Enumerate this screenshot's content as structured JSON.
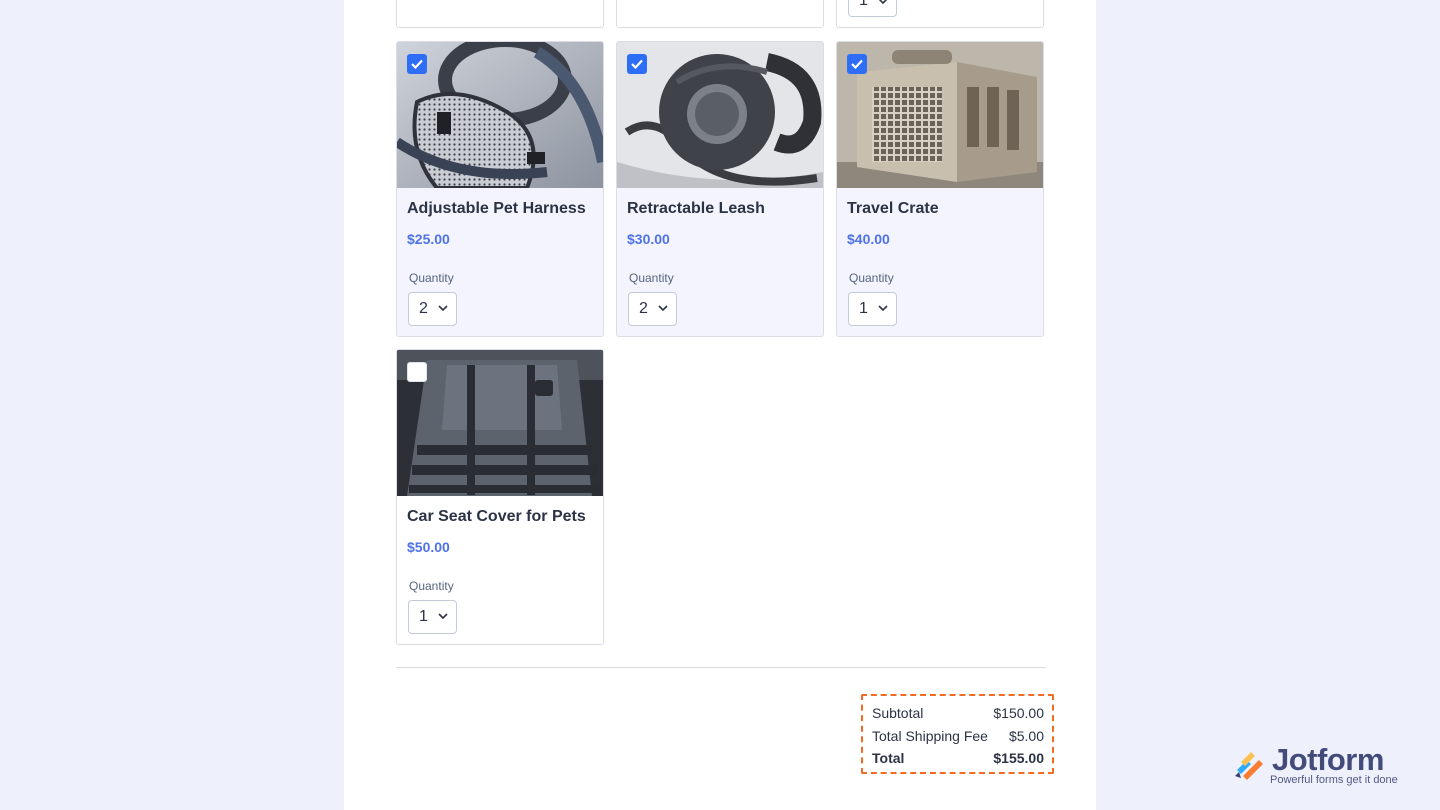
{
  "quantity_label": "Quantity",
  "accent_color": "#2e6ef7",
  "price_color": "#4f72e6",
  "summary_border_color": "#f26b22",
  "top_row_partial": {
    "visible_quantity": "1"
  },
  "products": [
    {
      "name": "Adjustable Pet Harness",
      "price": "$25.00",
      "quantity": "2",
      "selected": true,
      "icon": "harness-image"
    },
    {
      "name": "Retractable Leash",
      "price": "$30.00",
      "quantity": "2",
      "selected": true,
      "icon": "leash-image"
    },
    {
      "name": "Travel Crate",
      "price": "$40.00",
      "quantity": "1",
      "selected": true,
      "icon": "crate-image"
    },
    {
      "name": "Car Seat Cover for Pets",
      "price": "$50.00",
      "quantity": "1",
      "selected": false,
      "icon": "seat-cover-image"
    }
  ],
  "summary": {
    "subtotal_label": "Subtotal",
    "subtotal_value": "$150.00",
    "shipping_label": "Total Shipping Fee",
    "shipping_value": "$5.00",
    "total_label": "Total",
    "total_value": "$155.00"
  },
  "brand": {
    "name": "Jotform",
    "tagline": "Powerful forms get it done"
  }
}
